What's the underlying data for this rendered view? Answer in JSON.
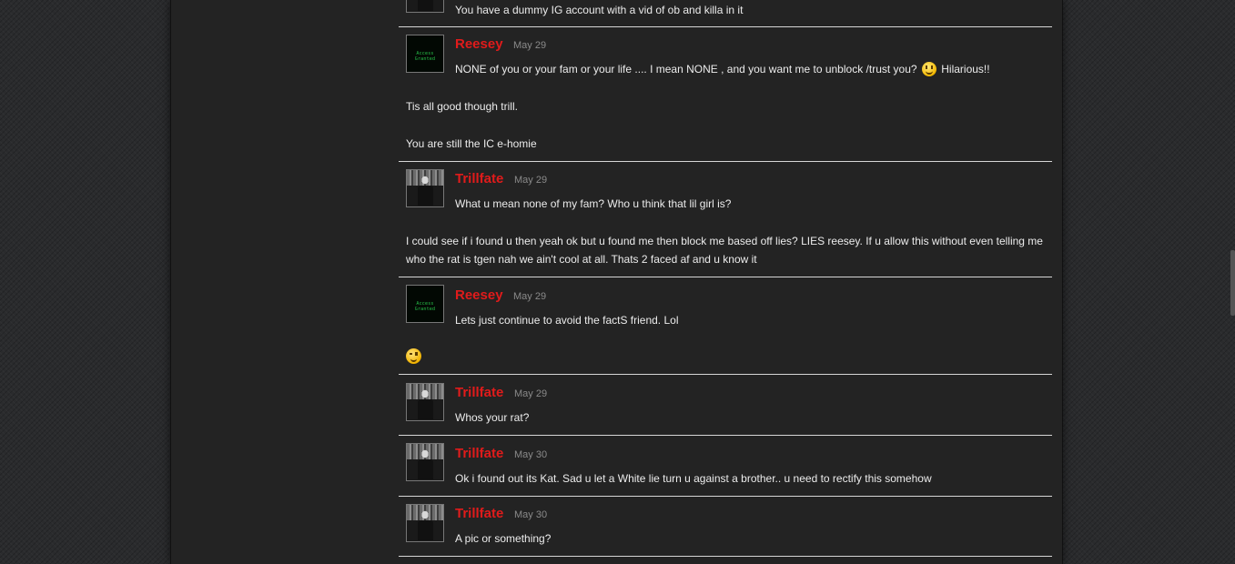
{
  "messages": [
    {
      "author": "",
      "date": "",
      "lines": [
        "You have a dummy IG account with a vid of ob and killa in it"
      ]
    },
    {
      "author": "Reesey",
      "date": "May 29",
      "avatar": "access-granted-avatar",
      "avatar_text": "Access Granted",
      "lines": [
        "NONE of you or your fam or your life .... I mean NONE , and you want me to unblock /trust you?",
        "Hilarious!!",
        "Tis all good though trill.",
        "You are still the IC e-homie"
      ]
    },
    {
      "author": "Trillfate",
      "date": "May 29",
      "avatar": "photo-avatar",
      "lines": [
        "What u mean none of my fam? Who u think that lil girl is?",
        "I could see if i found u then yeah ok but u found me then block me based off lies? LIES reesey. If u allow this without even telling me who the rat is tgen nah we ain't cool at all. Thats 2 faced af and u know it"
      ]
    },
    {
      "author": "Reesey",
      "date": "May 29",
      "avatar": "access-granted-avatar",
      "avatar_text": "Access Granted",
      "lines": [
        "Lets just continue to avoid the factS friend. Lol"
      ]
    },
    {
      "author": "Trillfate",
      "date": "May 29",
      "avatar": "photo-avatar",
      "lines": [
        "Whos your rat?"
      ]
    },
    {
      "author": "Trillfate",
      "date": "May 30",
      "avatar": "photo-avatar",
      "lines": [
        "Ok i found out its Kat. Sad u let a White lie turn u against a brother.. u need to rectify this somehow"
      ]
    },
    {
      "author": "Trillfate",
      "date": "May 30",
      "avatar": "photo-avatar",
      "lines": [
        "A pic or something?"
      ]
    }
  ],
  "colors": {
    "username": "#e01b1b",
    "text": "#ececec",
    "date": "#8a8a8a",
    "panel": "#232323",
    "separator": "#d6d6d6"
  }
}
